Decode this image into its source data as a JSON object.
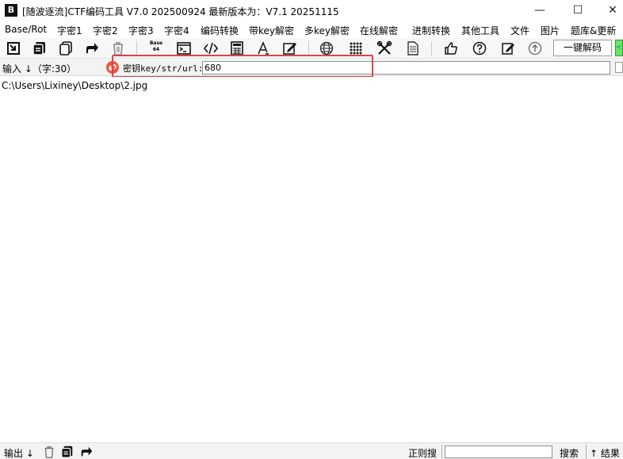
{
  "window": {
    "logo_text": "B",
    "title": "[随波逐流]CTF编码工具 V7.0 202500924    最新版本为：V7.1  20251115",
    "minimize_glyph": "—",
    "maximize_glyph": "☐",
    "close_glyph": "✕"
  },
  "menu": {
    "items": [
      {
        "label": "Base/Rot"
      },
      {
        "label": "字密1"
      },
      {
        "label": "字密2"
      },
      {
        "label": "字密3"
      },
      {
        "label": "字密4"
      },
      {
        "label": "编码转换"
      },
      {
        "label": "带key解密"
      },
      {
        "label": "多key解密"
      },
      {
        "label": "在线解密"
      },
      {
        "label": "进制转换"
      },
      {
        "label": "其他工具"
      },
      {
        "label": "文件"
      },
      {
        "label": "图片"
      },
      {
        "label": "题库&更新"
      }
    ]
  },
  "toolbar": {
    "icons": [
      "paste-in-icon",
      "copy-stack-icon",
      "copy-icon",
      "share-icon",
      "trash-icon",
      "base64-icon",
      "terminal-icon",
      "code-icon",
      "calculator-icon",
      "font-icon",
      "edit-box-icon",
      "globe-icon",
      "grid-icon",
      "tools-icon",
      "document-icon",
      "thumbs-up-icon",
      "help-icon",
      "pencil-icon",
      "arrow-up-icon"
    ],
    "base_icon_text_top": "Base",
    "base_icon_text_bottom": "64",
    "decode_button_label": "一键解码",
    "green_tab_label": "<"
  },
  "keyrow": {
    "input_label": "输入 ↓（字:30）",
    "key_label": "密钥key/str/url:",
    "key_value": "680"
  },
  "main": {
    "input_text": "C:\\Users\\Lixiney\\Desktop\\2.jpg"
  },
  "bottom": {
    "output_label": "输出 ↓",
    "regex_label": "正则搜",
    "search_value": "",
    "search_label": "搜索",
    "result_label": "↑ 结果"
  },
  "colors": {
    "highlight": "#e0424a",
    "key_icon": "#e8583a",
    "green_tab": "#6fe06f"
  }
}
